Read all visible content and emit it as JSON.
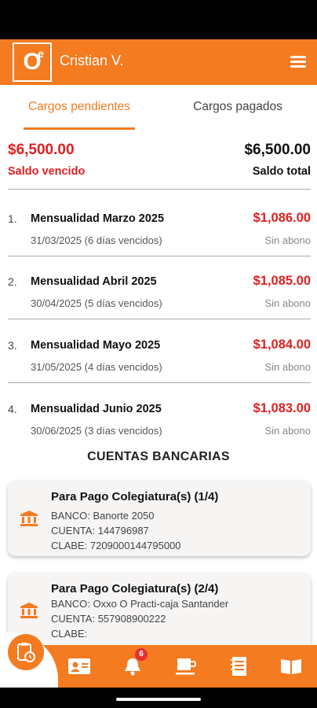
{
  "app": {
    "logo_letter": "O",
    "logo_sup": "e",
    "user_name": "Cristian V.",
    "accent_color": "#F47B20",
    "overdue_color": "#E02020"
  },
  "tabs": [
    {
      "label": "Cargos pendientes",
      "active": true
    },
    {
      "label": "Cargos pagados",
      "active": false
    }
  ],
  "summary": {
    "overdue_amount": "$6,500.00",
    "overdue_label": "Saldo vencido",
    "total_amount": "$6,500.00",
    "total_label": "Saldo total"
  },
  "charges": [
    {
      "index": "1.",
      "concept": "Mensualidad Marzo 2025",
      "amount": "$1,086.00",
      "date": "31/03/2025 (6 días vencidos)",
      "status": "Sin abono"
    },
    {
      "index": "2.",
      "concept": "Mensualidad Abril 2025",
      "amount": "$1,085.00",
      "date": "30/04/2025 (5 días vencidos)",
      "status": "Sin abono"
    },
    {
      "index": "3.",
      "concept": "Mensualidad Mayo 2025",
      "amount": "$1,084.00",
      "date": "31/05/2025 (4 días vencidos)",
      "status": "Sin abono"
    },
    {
      "index": "4.",
      "concept": "Mensualidad Junio 2025",
      "amount": "$1,083.00",
      "date": "30/06/2025 (3 días vencidos)",
      "status": "Sin abono"
    }
  ],
  "accounts_section": {
    "title": "CUENTAS BANCARIAS",
    "cards": [
      {
        "title": "Para Pago Colegiatura(s) (1/4)",
        "bank": "BANCO: Banorte 2050",
        "account": "CUENTA: 144796987",
        "clabe": "CLABE: 7209000144795000"
      },
      {
        "title": "Para Pago Colegiatura(s) (2/4)",
        "bank": "BANCO: Oxxo O Practi-caja Santander",
        "account": "CUENTA: 557908900222",
        "clabe": "CLABE:"
      }
    ]
  },
  "bottom_nav": {
    "notification_count": "6",
    "items": [
      "contacts-card-icon",
      "bell-icon",
      "coffee-cup-icon",
      "notebook-icon",
      "open-book-icon"
    ],
    "fab_icon": "clipboard-clock-icon"
  }
}
